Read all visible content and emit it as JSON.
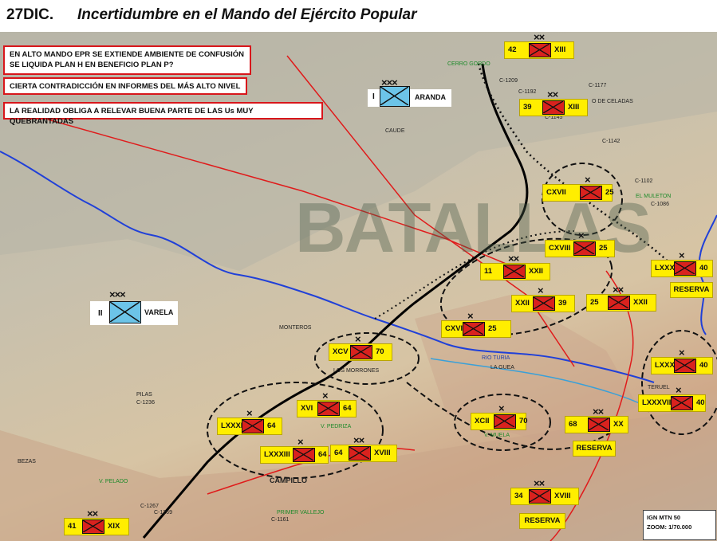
{
  "title": {
    "date": "27DIC.",
    "text": "Incertidumbre en el Mando del Ejército Popular"
  },
  "notes": [
    "EN ALTO MANDO EPR SE EXTIENDE AMBIENTE DE CONFUSIÓN SE LIQUIDA PLAN H EN BENEFICIO PLAN P?",
    "CIERTA CONTRADICCIÓN EN INFORMES DEL MÁS ALTO NIVEL",
    "LA REALIDAD OBLIGA A RELEVAR BUENA PARTE DE LAS Us MUY QUEBRANTADAS"
  ],
  "watermark": "BATALLAS",
  "nationalist_corps": [
    {
      "numeral": "I",
      "name": "ARANDA",
      "echelon": "×××"
    },
    {
      "numeral": "II",
      "name": "VARELA",
      "echelon": "×××"
    }
  ],
  "republican_units": [
    {
      "left": "42",
      "right": "XIII",
      "echelon": "××"
    },
    {
      "left": "39",
      "right": "XIII",
      "echelon": "××"
    },
    {
      "left": "CXVII",
      "right": "25",
      "echelon": "×"
    },
    {
      "left": "CXVIII",
      "right": "25",
      "echelon": "×"
    },
    {
      "left": "11",
      "right": "XXII",
      "echelon": "××"
    },
    {
      "left": "XXII",
      "right": "39",
      "echelon": "×"
    },
    {
      "left": "25",
      "right": "XXII",
      "echelon": "××"
    },
    {
      "left": "LXXXII",
      "right": "40",
      "echelon": "×"
    },
    {
      "left": "CXVI",
      "right": "25",
      "echelon": "×"
    },
    {
      "left": "XCV",
      "right": "70",
      "echelon": "×"
    },
    {
      "left": "LXXXIV",
      "right": "40",
      "echelon": "×"
    },
    {
      "left": "XVI",
      "right": "64",
      "echelon": "×"
    },
    {
      "left": "LXXXI",
      "right": "64",
      "echelon": "×"
    },
    {
      "left": "XCII",
      "right": "70",
      "echelon": "×"
    },
    {
      "left": "68",
      "right": "XX",
      "echelon": "××"
    },
    {
      "left": "LXXXVII",
      "right": "40",
      "echelon": "×"
    },
    {
      "left": "LXXXIII",
      "right": "64",
      "echelon": "×"
    },
    {
      "left": "64",
      "right": "XVIII",
      "echelon": "××"
    },
    {
      "left": "34",
      "right": "XVIII",
      "echelon": "××"
    },
    {
      "left": "41",
      "right": "XIX",
      "echelon": "××"
    }
  ],
  "reserve_labels": [
    "RESERVA",
    "RESERVA",
    "RESERVA"
  ],
  "places": [
    "CERRO GORDO",
    "C-1209",
    "C-1192",
    "C-1177",
    "C-1145",
    "O DE CELADAS",
    "C-1142",
    "CAUDE",
    "C-1102",
    "EL MULETON",
    "C-1086",
    "MONTEROS",
    "LOS MORRONES",
    "RIO TURIA",
    "LA GUEA",
    "TERUEL",
    "PILAS",
    "C-1236",
    "V. PEDRIZA",
    "V. MUELA",
    "BEZAS",
    "V. PELADO",
    "CAMPILLO",
    "C-1267",
    "C-1269",
    "C-1161",
    "PRIMER VALLEJO"
  ],
  "legend": {
    "line1": "IGN MTN 50",
    "line2": "ZOOM: 1/70.000"
  },
  "colors": {
    "republican": "#d9221e",
    "nationalist": "#6cc4e8",
    "label_bg": "#ffee00",
    "note_border": "#d8161b",
    "river": "#2040d8",
    "front": "#000000",
    "road": "#e01b1b"
  }
}
